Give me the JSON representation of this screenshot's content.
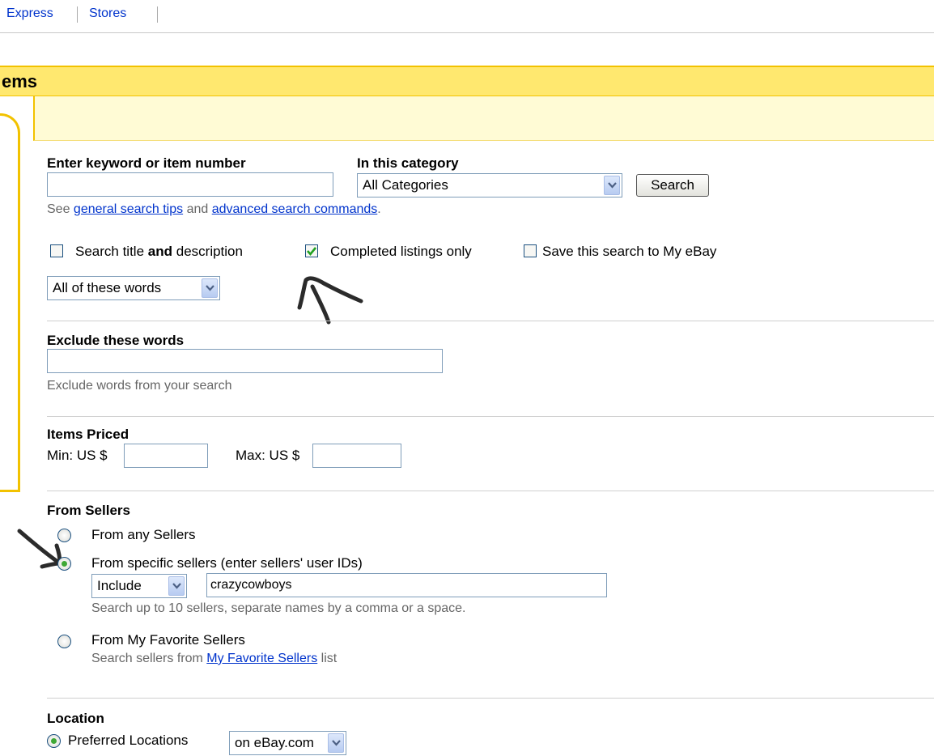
{
  "top_nav": {
    "items": [
      "Express",
      "Stores"
    ]
  },
  "header": {
    "title": "ems"
  },
  "keyword": {
    "label": "Enter keyword or item number",
    "value": "",
    "tip_prefix": "See",
    "tip_link1": "general search tips",
    "tip_mid": "and",
    "tip_link2": "advanced search commands",
    "tip_end": "."
  },
  "category": {
    "label": "In this category",
    "selected": "All Categories"
  },
  "search_button": "Search",
  "options": {
    "title_desc_pre": "Search title",
    "title_desc_bold": "and",
    "title_desc_post": "description",
    "title_desc_checked": false,
    "completed": "Completed listings only",
    "completed_checked": true,
    "save_search": "Save this search to My eBay",
    "save_checked": false
  },
  "words_mode": {
    "selected": "All of these words"
  },
  "exclude": {
    "label": "Exclude these words",
    "value": "",
    "hint": "Exclude words from your search"
  },
  "price": {
    "label": "Items Priced",
    "min_label": "Min: US $",
    "max_label": "Max: US $",
    "min": "",
    "max": ""
  },
  "sellers": {
    "label": "From Sellers",
    "any": "From any Sellers",
    "specific": "From specific sellers (enter sellers' user IDs)",
    "include_selected": "Include",
    "seller_ids": "crazycowboys",
    "hint": "Search up to 10 sellers, separate names by a comma or a space.",
    "favorite": "From My Favorite Sellers",
    "favorite_hint_pre": "Search sellers from",
    "favorite_link": "My Favorite Sellers",
    "favorite_hint_post": "list",
    "selected": "specific"
  },
  "location": {
    "label": "Location",
    "preferred": "Preferred Locations",
    "selected": "on eBay.com"
  },
  "colors": {
    "header_bg": "#ffe86f",
    "header_border": "#f2c200",
    "band_bg": "#fffbd5",
    "link": "#0033cc"
  }
}
